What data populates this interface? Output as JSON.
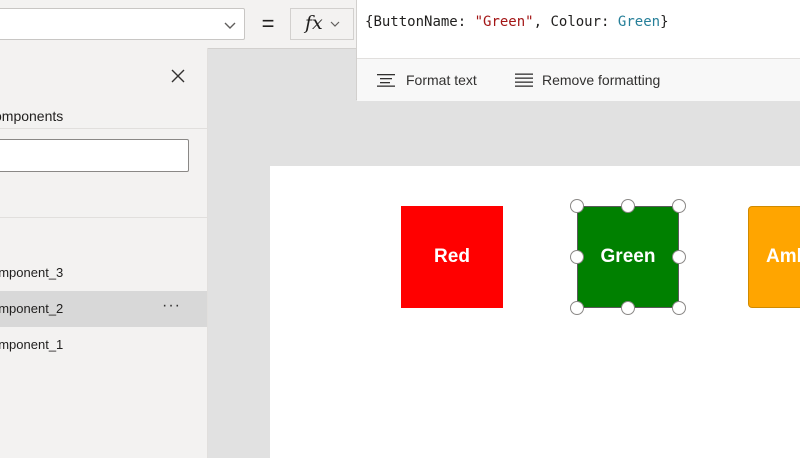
{
  "formula_bar": {
    "property_value": "",
    "equals": "=",
    "fx_label": "fx",
    "formula": {
      "open": "{",
      "key1": "ButtonName: ",
      "str1": "\"Green\"",
      "sep": ", ",
      "key2": "Colour: ",
      "val2": "Green",
      "close": "}"
    },
    "toolbar": {
      "format_text": "Format text",
      "remove_formatting": "Remove formatting"
    }
  },
  "left_pane": {
    "title": "omponents",
    "search_value": "",
    "items": [
      {
        "label": "omponent_3",
        "selected": false
      },
      {
        "label": "omponent_2",
        "selected": true
      },
      {
        "label": "omponent_1",
        "selected": false
      }
    ],
    "more_label": "···"
  },
  "canvas": {
    "buttons": [
      {
        "label": "Red",
        "color": "#ff0000"
      },
      {
        "label": "Green",
        "color": "#008000",
        "selected": true
      },
      {
        "label": "Amber",
        "color": "#ffa500"
      }
    ]
  },
  "colors": {
    "string_token": "#a31515",
    "value_token": "#267f99",
    "selected_row": "#d8d8d8"
  }
}
